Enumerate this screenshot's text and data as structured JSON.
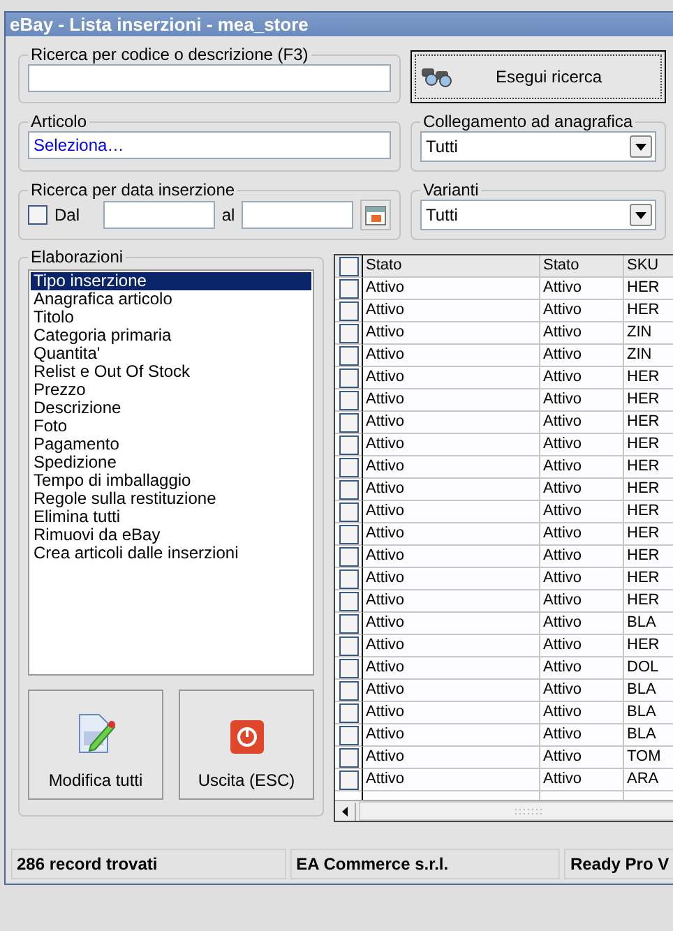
{
  "window": {
    "title": "eBay - Lista inserzioni - mea_store"
  },
  "search": {
    "label": "Ricerca per codice o descrizione (F3)"
  },
  "search_button": {
    "label": "Esegui ricerca"
  },
  "article": {
    "label": "Articolo",
    "value": "Seleziona…"
  },
  "link_filter": {
    "label": "Collegamento ad anagrafica",
    "value": "Tutti"
  },
  "date_search": {
    "label": "Ricerca per data inserzione",
    "from": {
      "label": "Dal",
      "checked": false
    },
    "to_label": "al"
  },
  "variants": {
    "label": "Varianti",
    "value": "Tutti"
  },
  "operations": {
    "label": "Elaborazioni",
    "items": [
      {
        "label": "Tipo inserzione",
        "selected": true
      },
      {
        "label": "Anagrafica articolo",
        "selected": false
      },
      {
        "label": "Titolo",
        "selected": false
      },
      {
        "label": "Categoria primaria",
        "selected": false
      },
      {
        "label": "Quantita'",
        "selected": false
      },
      {
        "label": "Relist e Out Of Stock",
        "selected": false
      },
      {
        "label": "Prezzo",
        "selected": false
      },
      {
        "label": "Descrizione",
        "selected": false
      },
      {
        "label": "Foto",
        "selected": false
      },
      {
        "label": "Pagamento",
        "selected": false
      },
      {
        "label": "Spedizione",
        "selected": false
      },
      {
        "label": "Tempo di imballaggio",
        "selected": false
      },
      {
        "label": "Regole sulla restituzione",
        "selected": false
      },
      {
        "label": "Elimina tutti",
        "selected": false
      },
      {
        "label": "Rimuovi da eBay",
        "selected": false
      },
      {
        "label": "Crea articoli dalle inserzioni",
        "selected": false
      }
    ]
  },
  "buttons": [
    {
      "label": "Modifica tutti",
      "kind": "edit"
    },
    {
      "label": "Uscita (ESC)",
      "kind": "exit"
    }
  ],
  "table": {
    "header_checked": false,
    "columns": [
      "Stato",
      "Stato",
      "SKU"
    ],
    "rows": [
      {
        "checked": false,
        "cells": [
          "Attivo",
          "Attivo",
          "HER"
        ]
      },
      {
        "checked": false,
        "cells": [
          "Attivo",
          "Attivo",
          "HER"
        ]
      },
      {
        "checked": false,
        "cells": [
          "Attivo",
          "Attivo",
          "ZIN"
        ]
      },
      {
        "checked": false,
        "cells": [
          "Attivo",
          "Attivo",
          "ZIN"
        ]
      },
      {
        "checked": false,
        "cells": [
          "Attivo",
          "Attivo",
          "HER"
        ]
      },
      {
        "checked": false,
        "cells": [
          "Attivo",
          "Attivo",
          "HER"
        ]
      },
      {
        "checked": false,
        "cells": [
          "Attivo",
          "Attivo",
          "HER"
        ]
      },
      {
        "checked": false,
        "cells": [
          "Attivo",
          "Attivo",
          "HER"
        ]
      },
      {
        "checked": false,
        "cells": [
          "Attivo",
          "Attivo",
          "HER"
        ]
      },
      {
        "checked": false,
        "cells": [
          "Attivo",
          "Attivo",
          "HER"
        ]
      },
      {
        "checked": false,
        "cells": [
          "Attivo",
          "Attivo",
          "HER"
        ]
      },
      {
        "checked": false,
        "cells": [
          "Attivo",
          "Attivo",
          "HER"
        ]
      },
      {
        "checked": false,
        "cells": [
          "Attivo",
          "Attivo",
          "HER"
        ]
      },
      {
        "checked": false,
        "cells": [
          "Attivo",
          "Attivo",
          "HER"
        ]
      },
      {
        "checked": false,
        "cells": [
          "Attivo",
          "Attivo",
          "HER"
        ]
      },
      {
        "checked": false,
        "cells": [
          "Attivo",
          "Attivo",
          "BLA"
        ]
      },
      {
        "checked": false,
        "cells": [
          "Attivo",
          "Attivo",
          "HER"
        ]
      },
      {
        "checked": false,
        "cells": [
          "Attivo",
          "Attivo",
          "DOL"
        ]
      },
      {
        "checked": false,
        "cells": [
          "Attivo",
          "Attivo",
          "BLA"
        ]
      },
      {
        "checked": false,
        "cells": [
          "Attivo",
          "Attivo",
          "BLA"
        ]
      },
      {
        "checked": false,
        "cells": [
          "Attivo",
          "Attivo",
          "BLA"
        ]
      },
      {
        "checked": false,
        "cells": [
          "Attivo",
          "Attivo",
          "TOM"
        ]
      },
      {
        "checked": false,
        "cells": [
          "Attivo",
          "Attivo",
          "ARA"
        ]
      }
    ]
  },
  "status_bar": [
    "286 record trovati",
    "EA Commerce s.r.l.",
    "Ready Pro V"
  ]
}
